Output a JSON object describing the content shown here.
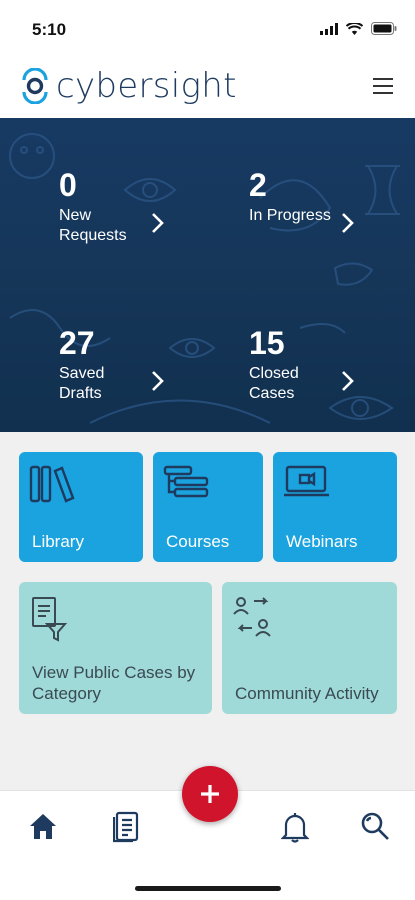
{
  "status": {
    "time": "5:10"
  },
  "header": {
    "logo_text": "cybersight",
    "menu_icon": "hamburger-menu-icon"
  },
  "colors": {
    "navy": "#173a63",
    "tile_blue": "#1aa3df",
    "tile_teal": "#9fdad8",
    "fab_red": "#d0142c"
  },
  "stats": [
    {
      "count": "0",
      "label": "New Requests"
    },
    {
      "count": "2",
      "label": "In Progress"
    },
    {
      "count": "27",
      "label": "Saved Drafts"
    },
    {
      "count": "15",
      "label": "Closed Cases"
    }
  ],
  "tiles": {
    "library": "Library",
    "courses": "Courses",
    "webinars": "Webinars",
    "public_cases": "View Public Cases by Category",
    "community": "Community Activity"
  },
  "tabbar": {
    "items": [
      "home-icon",
      "cases-icon",
      "notifications-icon",
      "search-icon"
    ],
    "fab_icon": "plus-icon"
  }
}
